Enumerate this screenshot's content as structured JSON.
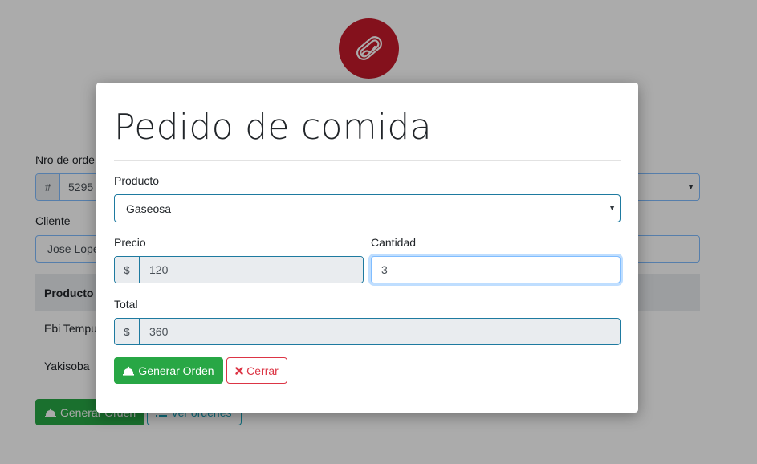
{
  "background": {
    "order_label": "Nro de orde",
    "order_prefix": "#",
    "order_value": "5295",
    "client_label": "Cliente",
    "client_value": "Jose Lope",
    "table_header": "Producto",
    "rows": [
      "Ebi Tempu",
      "Yakisoba"
    ],
    "generate_button": "Generar Orden",
    "view_button": "Ver órdenes"
  },
  "modal": {
    "title": "Pedido de comida",
    "product_label": "Producto",
    "product_selected": "Gaseosa",
    "price_label": "Precio",
    "price_prefix": "$",
    "price_value": "120",
    "quantity_label": "Cantidad",
    "quantity_value": "3",
    "total_label": "Total",
    "total_prefix": "$",
    "total_value": "360",
    "generate_button": "Generar Orden",
    "close_button": "Cerrar"
  },
  "colors": {
    "logo": "#c51a2b",
    "success": "#28a745",
    "danger": "#dc3545",
    "info": "#17a2b8"
  },
  "icons": {
    "logo": "hotdog-icon",
    "generate": "bell-icon",
    "close": "times-icon",
    "list": "list-icon",
    "select_caret": "caret-down-icon"
  }
}
